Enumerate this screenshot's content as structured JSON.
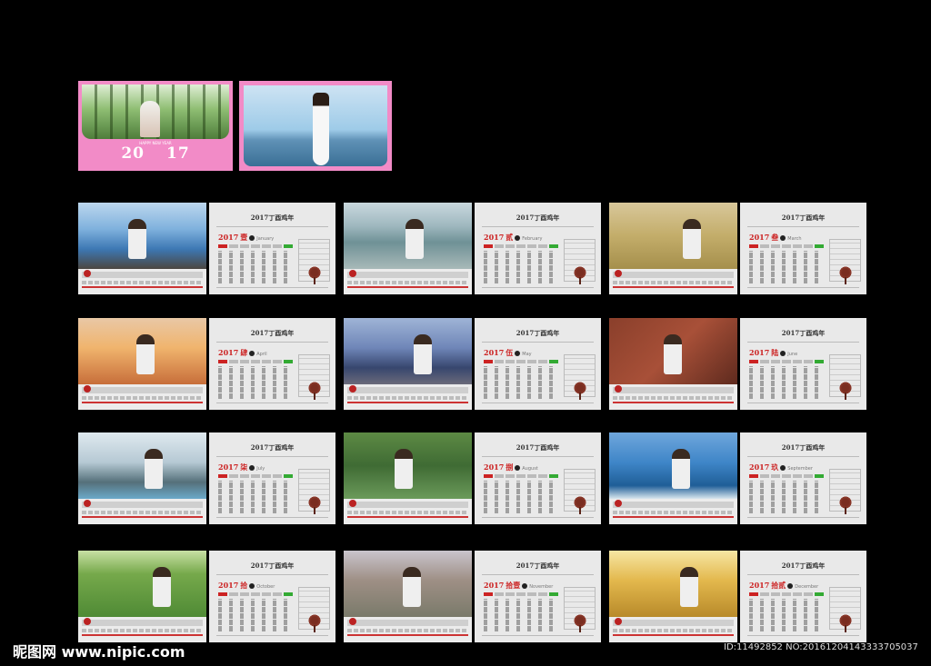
{
  "cover": {
    "subtitle": "HAPPY NEW YEAR",
    "year_left": "20",
    "year_right": "17"
  },
  "months": [
    {
      "title": "2017丁酉鸡年",
      "year": "2017",
      "cn": "壹",
      "en": "January",
      "scene": "sea"
    },
    {
      "title": "2017丁酉鸡年",
      "year": "2017",
      "cn": "贰",
      "en": "February",
      "scene": "sea-grey"
    },
    {
      "title": "2017丁酉鸡年",
      "year": "2017",
      "cn": "叁",
      "en": "March",
      "scene": "field"
    },
    {
      "title": "2017丁酉鸡年",
      "year": "2017",
      "cn": "肆",
      "en": "April",
      "scene": "sunset"
    },
    {
      "title": "2017丁酉鸡年",
      "year": "2017",
      "cn": "伍",
      "en": "May",
      "scene": "beach-dusk"
    },
    {
      "title": "2017丁酉鸡年",
      "year": "2017",
      "cn": "陆",
      "en": "June",
      "scene": "brick"
    },
    {
      "title": "2017丁酉鸡年",
      "year": "2017",
      "cn": "柒",
      "en": "July",
      "scene": "mountain"
    },
    {
      "title": "2017丁酉鸡年",
      "year": "2017",
      "cn": "捌",
      "en": "August",
      "scene": "forest"
    },
    {
      "title": "2017丁酉鸡年",
      "year": "2017",
      "cn": "玖",
      "en": "September",
      "scene": "blue-sea"
    },
    {
      "title": "2017丁酉鸡年",
      "year": "2017",
      "cn": "拾",
      "en": "October",
      "scene": "tea"
    },
    {
      "title": "2017丁酉鸡年",
      "year": "2017",
      "cn": "拾壹",
      "en": "November",
      "scene": "street"
    },
    {
      "title": "2017丁酉鸡年",
      "year": "2017",
      "cn": "拾贰",
      "en": "December",
      "scene": "wheat"
    }
  ],
  "watermark": "昵图网 www.nipic.com",
  "image_id": "ID:11492852 NO:20161204143333705037"
}
